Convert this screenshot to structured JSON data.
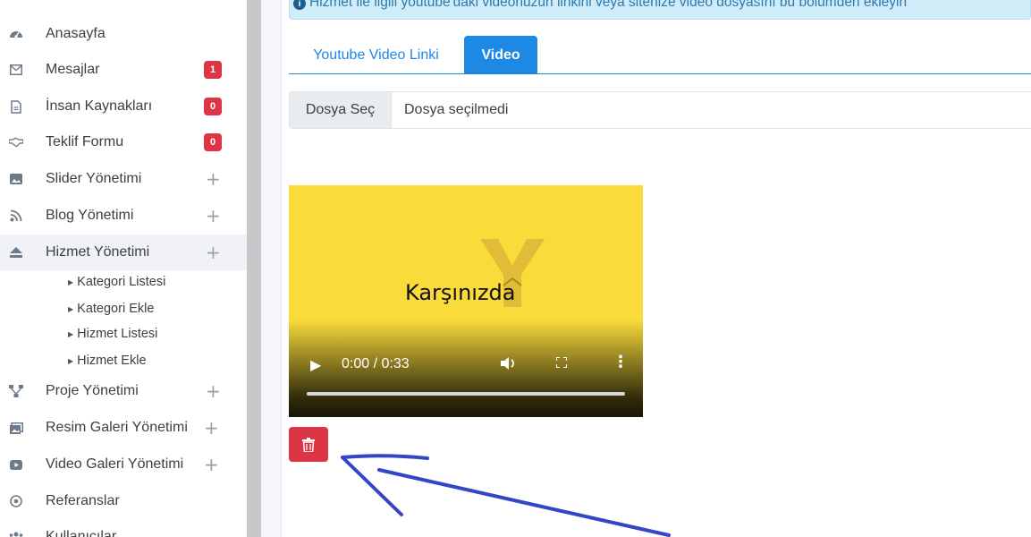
{
  "sidebar": {
    "items": [
      {
        "label": "Anasayfa",
        "icon": "dashboard-icon"
      },
      {
        "label": "Mesajlar",
        "icon": "envelope-icon",
        "badge": "1"
      },
      {
        "label": "İnsan Kaynakları",
        "icon": "document-icon",
        "badge": "0"
      },
      {
        "label": "Teklif Formu",
        "icon": "handshake-icon",
        "badge": "0"
      },
      {
        "label": "Slider Yönetimi",
        "icon": "image-icon",
        "expand": "+"
      },
      {
        "label": "Blog Yönetimi",
        "icon": "rss-icon",
        "expand": "+"
      },
      {
        "label": "Hizmet Yönetimi",
        "icon": "eject-icon",
        "expand": "+"
      },
      {
        "label": "Proje Yönetimi",
        "icon": "sitemap-icon",
        "expand": "+"
      },
      {
        "label": "Resim Galeri Yönetimi",
        "icon": "images-icon",
        "expand": "+"
      },
      {
        "label": "Video Galeri Yönetimi",
        "icon": "youtube-icon",
        "expand": "+"
      },
      {
        "label": "Referanslar",
        "icon": "target-icon"
      },
      {
        "label": "Kullanıcılar",
        "icon": "users-icon"
      }
    ],
    "submenu": [
      {
        "label": "Kategori Listesi"
      },
      {
        "label": "Kategori Ekle"
      },
      {
        "label": "Hizmet Listesi"
      },
      {
        "label": "Hizmet Ekle"
      }
    ]
  },
  "alert": {
    "text": "Hizmet ile ilgili youtube'daki videonuzun linkini veya sitenize video dosyasını bu bölümden ekleyin"
  },
  "tabs": [
    {
      "label": "Youtube Video Linki",
      "active": false
    },
    {
      "label": "Video",
      "active": true
    }
  ],
  "file_input": {
    "button_label": "Dosya Seç",
    "status": "Dosya seçilmedi"
  },
  "video": {
    "caption": "Karşınızda",
    "time": "0:00 / 0:33",
    "progress": 0
  },
  "colors": {
    "primary": "#1e88e5",
    "danger": "#dc3545",
    "video_bg": "#f9dc3a",
    "annotation": "#3346c8"
  }
}
